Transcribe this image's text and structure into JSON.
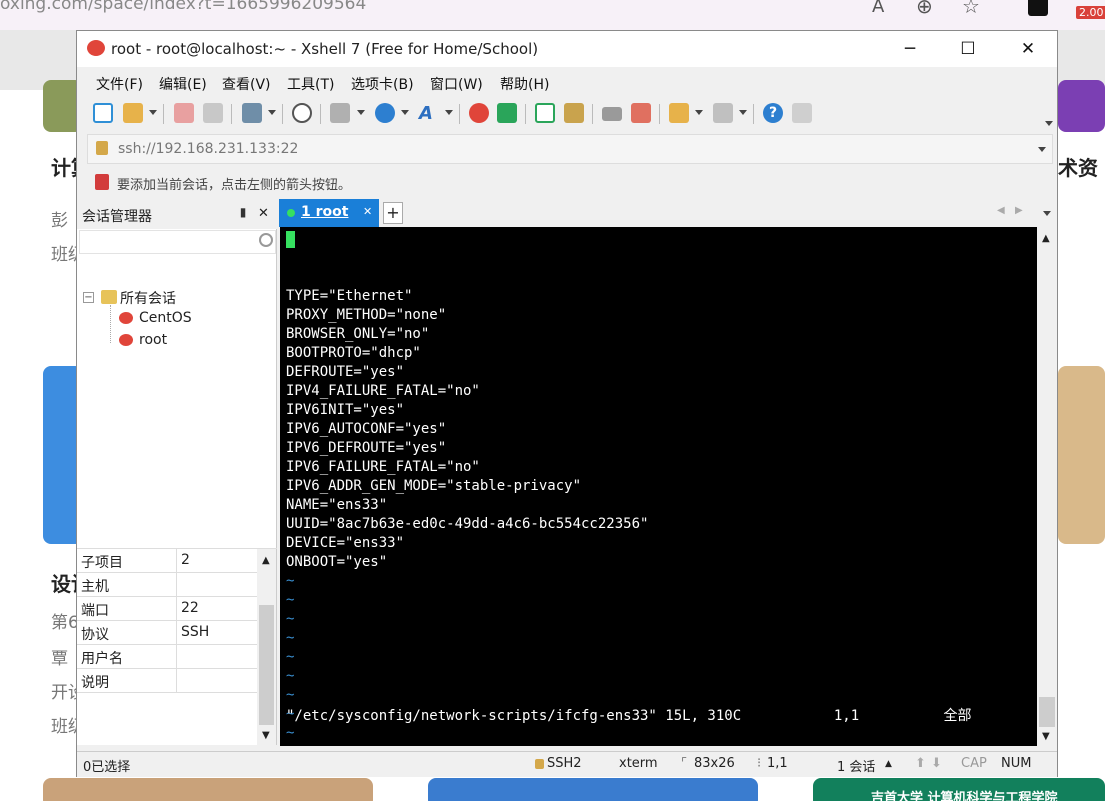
{
  "browser": {
    "url": "oxing.com/space/index?t=1665996209564",
    "zoom_badge": "2.00",
    "bg_texts": [
      "计算",
      "彭",
      "班级",
      "设计",
      "第6",
      "覃",
      "开设",
      "班级",
      "术资",
      "吉首大学 计算机科学与工程学院"
    ]
  },
  "window": {
    "title": "root - root@localhost:~ - Xshell 7 (Free for Home/School)",
    "minimize": "─",
    "maximize": "☐",
    "close": "✕"
  },
  "menu": [
    "文件(F)",
    "编辑(E)",
    "查看(V)",
    "工具(T)",
    "选项卡(B)",
    "窗口(W)",
    "帮助(H)"
  ],
  "address": {
    "value": "ssh://192.168.231.133:22"
  },
  "hint": {
    "text": "要添加当前会话，点击左侧的箭头按钮。"
  },
  "session_manager": {
    "title": "会话管理器",
    "pin": "📌",
    "close": "✕",
    "tree_root": "所有会话",
    "items": [
      "CentOS",
      "root"
    ]
  },
  "properties": [
    {
      "key": "子项目",
      "value": "2"
    },
    {
      "key": "主机",
      "value": ""
    },
    {
      "key": "端口",
      "value": "22"
    },
    {
      "key": "协议",
      "value": "SSH"
    },
    {
      "key": "用户名",
      "value": ""
    },
    {
      "key": "说明",
      "value": ""
    }
  ],
  "tabs": [
    {
      "label": "1 root",
      "close": "✕"
    }
  ],
  "tab_add": "+",
  "terminal": {
    "lines": [
      "TYPE=\"Ethernet\"",
      "PROXY_METHOD=\"none\"",
      "BROWSER_ONLY=\"no\"",
      "BOOTPROTO=\"dhcp\"",
      "DEFROUTE=\"yes\"",
      "IPV4_FAILURE_FATAL=\"no\"",
      "IPV6INIT=\"yes\"",
      "IPV6_AUTOCONF=\"yes\"",
      "IPV6_DEFROUTE=\"yes\"",
      "IPV6_FAILURE_FATAL=\"no\"",
      "IPV6_ADDR_GEN_MODE=\"stable-privacy\"",
      "NAME=\"ens33\"",
      "UUID=\"8ac7b63e-ed0c-49dd-a4c6-bc554cc22356\"",
      "DEVICE=\"ens33\"",
      "ONBOOT=\"yes\""
    ],
    "tilde_rows": 10,
    "status": "\"/etc/sysconfig/network-scripts/ifcfg-ens33\" 15L, 310C           1,1          全部"
  },
  "statusbar": {
    "selection": "0已选择",
    "protocol": "SSH2",
    "term": "xterm",
    "size": "83x26",
    "pos": "1,1",
    "sessions": "1 会话",
    "cap": "CAP",
    "num": "NUM"
  },
  "colors": {
    "accent": "#1a7fd8",
    "cursor": "#36e060",
    "tilde": "#3a8fd0"
  }
}
